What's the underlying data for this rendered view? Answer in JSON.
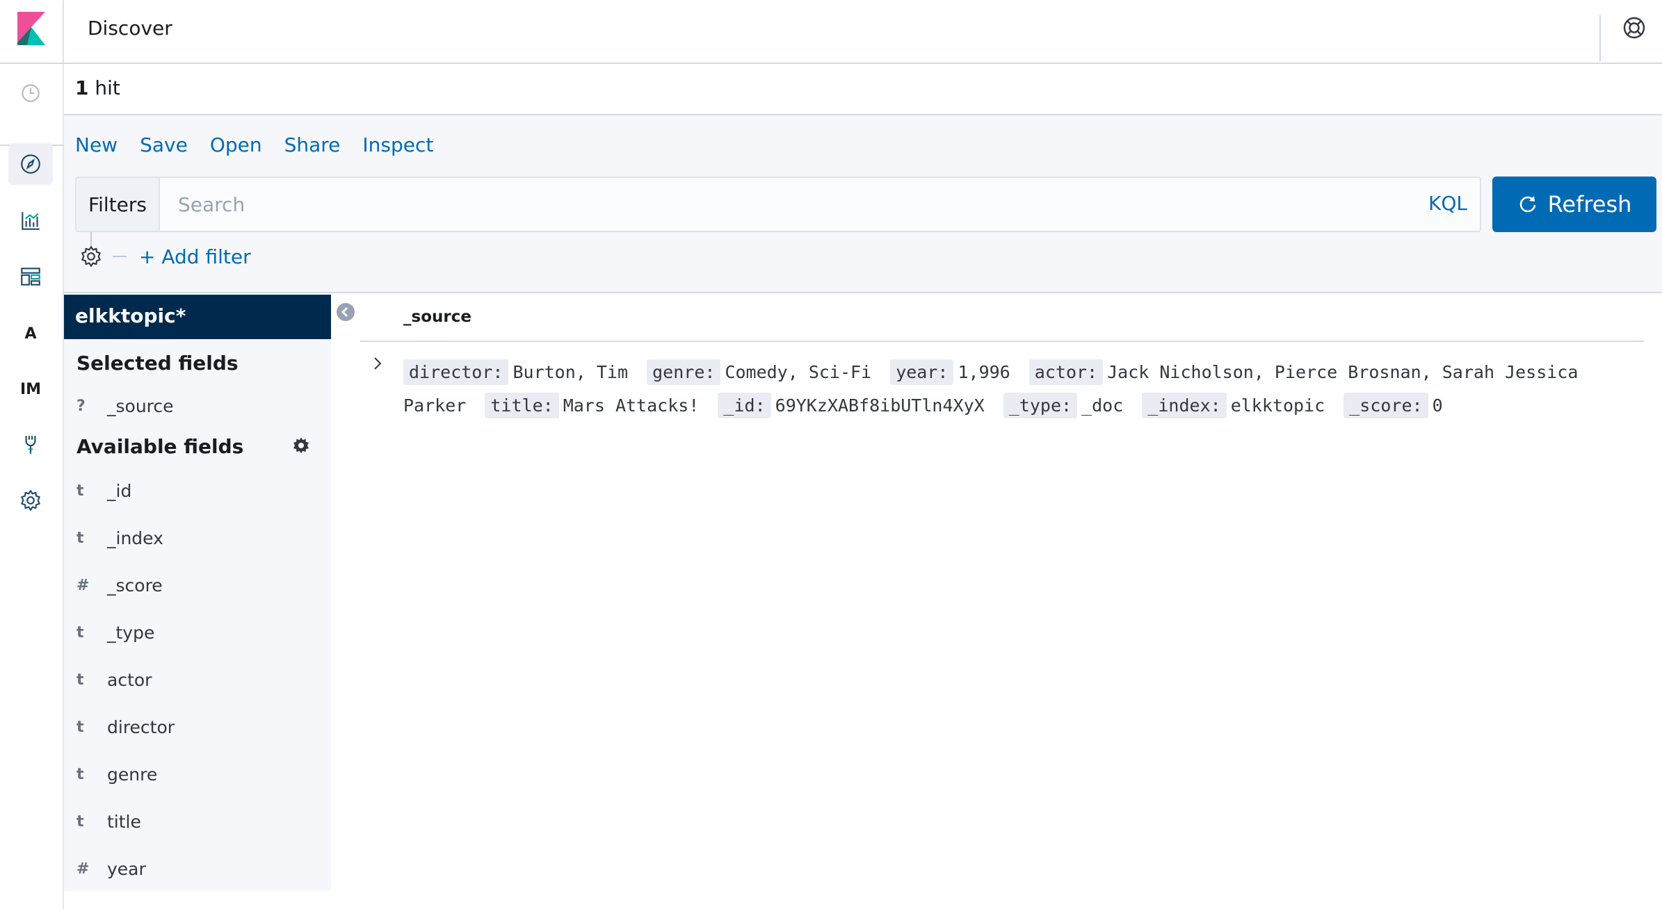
{
  "header": {
    "title": "Discover"
  },
  "hits": {
    "count": "1",
    "label": "hit"
  },
  "menu": [
    "New",
    "Save",
    "Open",
    "Share",
    "Inspect"
  ],
  "search": {
    "filters_label": "Filters",
    "placeholder": "Search",
    "language": "KQL",
    "refresh_label": "Refresh"
  },
  "filter_bar": {
    "add_filter": "+ Add filter"
  },
  "sidebar": {
    "index_pattern": "elkktopic*",
    "selected_title": "Selected fields",
    "selected_fields": [
      {
        "type": "?",
        "name": "_source"
      }
    ],
    "available_title": "Available fields",
    "available_fields": [
      {
        "type": "t",
        "name": "_id"
      },
      {
        "type": "t",
        "name": "_index"
      },
      {
        "type": "#",
        "name": "_score"
      },
      {
        "type": "t",
        "name": "_type"
      },
      {
        "type": "t",
        "name": "actor"
      },
      {
        "type": "t",
        "name": "director"
      },
      {
        "type": "t",
        "name": "genre"
      },
      {
        "type": "t",
        "name": "title"
      },
      {
        "type": "#",
        "name": "year"
      }
    ]
  },
  "nav": {
    "letters": [
      "A",
      "IM"
    ],
    "icons": [
      "clock-icon",
      "discover-compass-icon",
      "visualize-icon",
      "dashboard-icon",
      "maps-letter-a",
      "infra-letters-im",
      "dev-tools-icon",
      "management-gear-icon"
    ]
  },
  "doc_table": {
    "column": "_source",
    "rows": [
      {
        "fields": [
          {
            "key": "director:",
            "value": "Burton, Tim"
          },
          {
            "key": "genre:",
            "value": "Comedy, Sci-Fi"
          },
          {
            "key": "year:",
            "value": "1,996"
          },
          {
            "key": "actor:",
            "value": "Jack Nicholson, Pierce Brosnan, Sarah Jessica Parker"
          },
          {
            "key": "title:",
            "value": "Mars Attacks!"
          },
          {
            "key": "_id:",
            "value": "69YKzXABf8ibUTln4XyX"
          },
          {
            "key": "_type:",
            "value": "_doc"
          },
          {
            "key": "_index:",
            "value": "elkktopic"
          },
          {
            "key": "_score:",
            "value": "0"
          }
        ]
      }
    ]
  },
  "colors": {
    "accent": "#006bb4",
    "index_bg": "#002a4d"
  }
}
